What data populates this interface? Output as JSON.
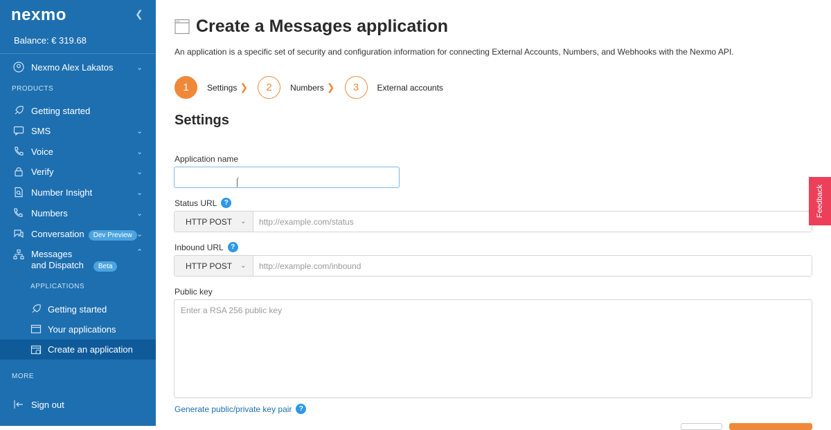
{
  "brand": {
    "logo_text": "nexmo",
    "accent": "#f0883a",
    "sidebar_bg": "#1d6fb0"
  },
  "sidebar": {
    "balance": "Balance: € 319.68",
    "account_name": "Nexmo Alex Lakatos",
    "products_label": "PRODUCTS",
    "items": [
      {
        "label": "Getting started",
        "icon": "rocket-icon"
      },
      {
        "label": "SMS",
        "icon": "chat-icon"
      },
      {
        "label": "Voice",
        "icon": "phone-icon"
      },
      {
        "label": "Verify",
        "icon": "lock-icon"
      },
      {
        "label": "Number Insight",
        "icon": "document-search-icon"
      },
      {
        "label": "Numbers",
        "icon": "phone-list-icon"
      },
      {
        "label": "Conversation",
        "icon": "conversation-icon",
        "badge": "Dev Preview"
      },
      {
        "label": "Messages",
        "label2": "and Dispatch",
        "icon": "hierarchy-icon",
        "badge": "Beta"
      }
    ],
    "applications_label": "APPLICATIONS",
    "sub_items": [
      {
        "label": "Getting started",
        "icon": "rocket-icon"
      },
      {
        "label": "Your applications",
        "icon": "window-icon"
      },
      {
        "label": "Create an application",
        "icon": "add-window-icon"
      }
    ],
    "more_label": "MORE",
    "sign_out": "Sign out"
  },
  "main": {
    "title": "Create a Messages application",
    "intro": "An application is a specific set of security and configuration information for connecting External Accounts, Numbers, and Webhooks with the Nexmo API.",
    "steps": [
      {
        "number": "1",
        "label": "Settings"
      },
      {
        "number": "2",
        "label": "Numbers"
      },
      {
        "number": "3",
        "label": "External accounts"
      }
    ],
    "settings_heading": "Settings",
    "app_name_label": "Application name",
    "app_name_value": "",
    "status_url_label": "Status URL",
    "status_method": "HTTP POST",
    "status_placeholder": "http://example.com/status",
    "inbound_url_label": "Inbound URL",
    "inbound_method": "HTTP POST",
    "inbound_placeholder": "http://example.com/inbound",
    "public_key_label": "Public key",
    "public_key_placeholder": "Enter a RSA 256 public key",
    "generate_link": "Generate public/private key pair",
    "help_glyph": "?"
  },
  "feedback_tab": "Feedback"
}
